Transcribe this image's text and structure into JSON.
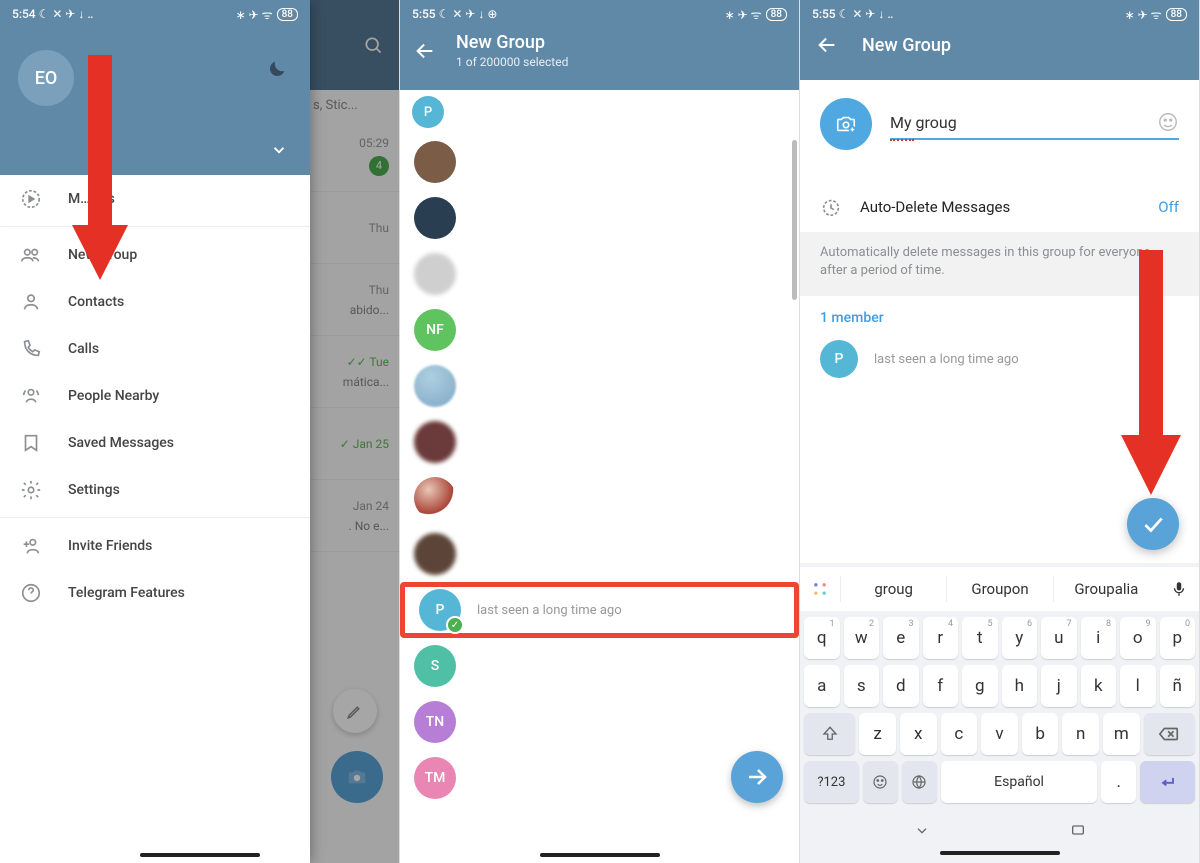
{
  "panel1": {
    "status": {
      "time": "5:54",
      "icons": "☾ ✕ ✈ ↓ ‥",
      "right": "∗ ✈ ᯤ",
      "batt": "88"
    },
    "avatar_initials": "EO",
    "menu_top_partial": "M……és",
    "menu": {
      "new_group": "New Group",
      "contacts": "Contacts",
      "calls": "Calls",
      "people_nearby": "People Nearby",
      "saved_messages": "Saved Messages",
      "settings": "Settings",
      "invite_friends": "Invite Friends",
      "telegram_features": "Telegram Features"
    },
    "bg": {
      "stic": "s, Stic...",
      "t1": "05:29",
      "badge1": "4",
      "t2": "Thu",
      "t3": "Thu",
      "txt3": "abido...",
      "t4": "✓✓ Tue",
      "txt4": "mática...",
      "t5": "✓ Jan 25",
      "t6": "Jan 24",
      "txt6": ". No e..."
    }
  },
  "panel2": {
    "status": {
      "time": "5:55",
      "icons": "☾ ✕ ✈ ↓ ⊕",
      "right": "∗ ✈ ᯤ",
      "batt": "88"
    },
    "title": "New Group",
    "subtitle": "1 of 200000 selected",
    "chip": "P",
    "selected_status": "last seen a long time ago",
    "avatars": {
      "nf": "NF",
      "s": "S",
      "tn": "TN",
      "tm": "TM",
      "p": "P"
    }
  },
  "panel3": {
    "status": {
      "time": "5:55",
      "icons": "☾ ✕ ✈ ↓ ‥",
      "right": "∗ ✈ ᯤ",
      "batt": "88"
    },
    "title": "New Group",
    "group_name": "My groug",
    "autodel_label": "Auto-Delete Messages",
    "autodel_value": "Off",
    "autodel_hint": "Automatically delete messages in this group for everyone after a period of time.",
    "members_header": "1 member",
    "member_avatar": "P",
    "member_status": "last seen a long time ago",
    "keyboard": {
      "suggestions": [
        "groug",
        "Groupon",
        "Groupalia"
      ],
      "row1": [
        [
          "q",
          "1"
        ],
        [
          "w",
          "2"
        ],
        [
          "e",
          "3"
        ],
        [
          "r",
          "4"
        ],
        [
          "t",
          "5"
        ],
        [
          "y",
          "6"
        ],
        [
          "u",
          "7"
        ],
        [
          "i",
          "8"
        ],
        [
          "o",
          "9"
        ],
        [
          "p",
          "0"
        ]
      ],
      "row2": [
        "a",
        "s",
        "d",
        "f",
        "g",
        "h",
        "j",
        "k",
        "l",
        "ñ"
      ],
      "row3": [
        "z",
        "x",
        "c",
        "v",
        "b",
        "n",
        "m"
      ],
      "numkey": "?123",
      "space": "Español",
      "period": "."
    }
  }
}
